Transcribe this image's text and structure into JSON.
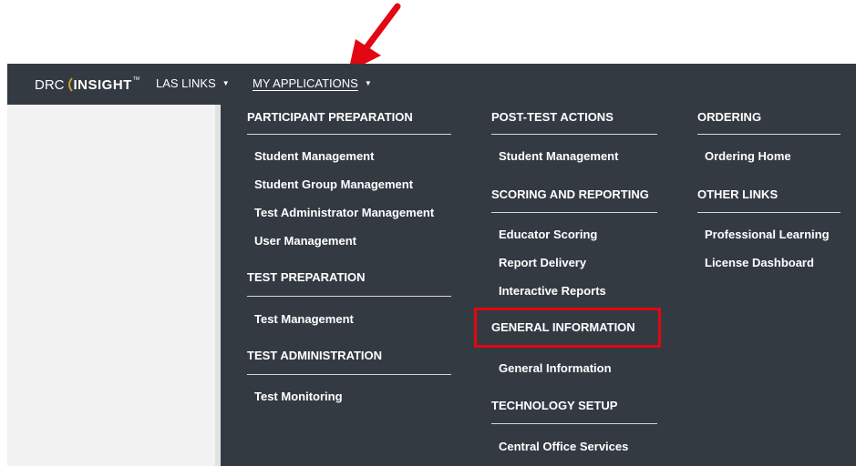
{
  "header": {
    "logo": {
      "drc": "DRC",
      "insight": "INSIGHT",
      "tm": "TM"
    },
    "nav": [
      {
        "label": "LAS LINKS",
        "icon": "caret-down-icon"
      },
      {
        "label": "MY APPLICATIONS",
        "icon": "caret-down-icon"
      }
    ]
  },
  "menu": {
    "participant_preparation": {
      "heading": "PARTICIPANT PREPARATION",
      "items": [
        "Student Management",
        "Student Group Management",
        "Test Administrator Management",
        "User Management"
      ]
    },
    "test_preparation": {
      "heading": "TEST PREPARATION",
      "items": [
        "Test Management"
      ]
    },
    "test_administration": {
      "heading": "TEST ADMINISTRATION",
      "items": [
        "Test Monitoring"
      ]
    },
    "post_test_actions": {
      "heading": "POST-TEST ACTIONS",
      "items": [
        "Student Management"
      ]
    },
    "scoring_and_reporting": {
      "heading": "SCORING AND REPORTING",
      "items": [
        "Educator Scoring",
        "Report Delivery",
        "Interactive Reports"
      ]
    },
    "general_information": {
      "heading": "GENERAL INFORMATION",
      "items": [
        "General Information"
      ]
    },
    "technology_setup": {
      "heading": "TECHNOLOGY SETUP",
      "items": [
        "Central Office Services"
      ]
    },
    "ordering": {
      "heading": "ORDERING",
      "items": [
        "Ordering Home"
      ]
    },
    "other_links": {
      "heading": "OTHER LINKS",
      "items": [
        "Professional Learning",
        "License Dashboard"
      ]
    }
  },
  "annotations": {
    "arrow_color": "#e30613",
    "highlight_color": "#e30613"
  },
  "colors": {
    "navbar": "#343a42",
    "dropdown": "#343a42",
    "sidebar": "#f2f2f2"
  }
}
